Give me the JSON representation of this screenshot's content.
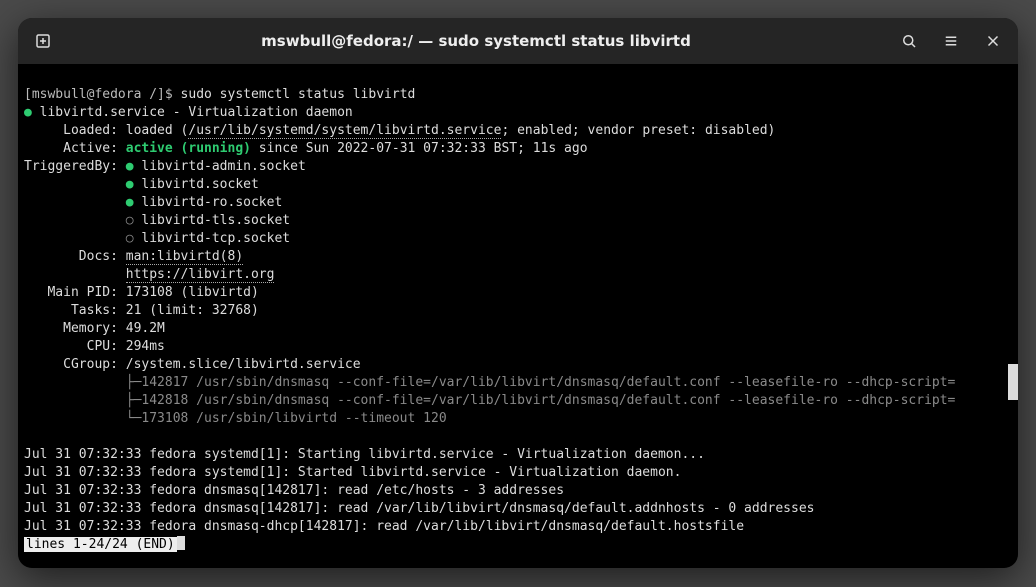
{
  "titlebar": {
    "title": "mswbull@fedora:/ — sudo systemctl status libvirtd"
  },
  "prompt": {
    "text": "[mswbull@fedora /]$ ",
    "command": "sudo systemctl status libvirtd"
  },
  "svc": {
    "header_name": "libvirtd.service",
    "header_desc": " - Virtualization daemon",
    "loaded_label": "     Loaded: ",
    "loaded_pre": "loaded (",
    "loaded_path": "/usr/lib/systemd/system/libvirtd.service",
    "loaded_post": "; enabled; vendor preset: disabled)",
    "active_label": "     Active: ",
    "active_state": "active (running)",
    "active_since": " since Sun 2022-07-31 07:32:33 BST; 11s ago",
    "trig_label": "TriggeredBy: ",
    "triggers": [
      {
        "on": true,
        "name": "libvirtd-admin.socket"
      },
      {
        "on": true,
        "name": "libvirtd.socket"
      },
      {
        "on": true,
        "name": "libvirtd-ro.socket"
      },
      {
        "on": false,
        "name": "libvirtd-tls.socket"
      },
      {
        "on": false,
        "name": "libvirtd-tcp.socket"
      }
    ],
    "docs_label": "       Docs: ",
    "doc1": "man:libvirtd(8)",
    "doc2": "https://libvirt.org",
    "pid_label": "   Main PID: ",
    "pid_val": "173108 (libvirtd)",
    "tasks_label": "      Tasks: ",
    "tasks_val": "21 (limit: 32768)",
    "mem_label": "     Memory: ",
    "mem_val": "49.2M",
    "cpu_label": "        CPU: ",
    "cpu_val": "294ms",
    "cgroup_label": "     CGroup: ",
    "cgroup_val": "/system.slice/libvirtd.service",
    "proc1": "             ├─142817 /usr/sbin/dnsmasq --conf-file=/var/lib/libvirt/dnsmasq/default.conf --leasefile-ro --dhcp-script=",
    "proc2": "             ├─142818 /usr/sbin/dnsmasq --conf-file=/var/lib/libvirt/dnsmasq/default.conf --leasefile-ro --dhcp-script=",
    "proc3": "             └─173108 /usr/sbin/libvirtd --timeout 120"
  },
  "log": [
    "Jul 31 07:32:33 fedora systemd[1]: Starting libvirtd.service - Virtualization daemon...",
    "Jul 31 07:32:33 fedora systemd[1]: Started libvirtd.service - Virtualization daemon.",
    "Jul 31 07:32:33 fedora dnsmasq[142817]: read /etc/hosts - 3 addresses",
    "Jul 31 07:32:33 fedora dnsmasq[142817]: read /var/lib/libvirt/dnsmasq/default.addnhosts - 0 addresses",
    "Jul 31 07:32:33 fedora dnsmasq-dhcp[142817]: read /var/lib/libvirt/dnsmasq/default.hostsfile"
  ],
  "pager": "lines 1-24/24 (END)",
  "scroll_glyph": ">"
}
